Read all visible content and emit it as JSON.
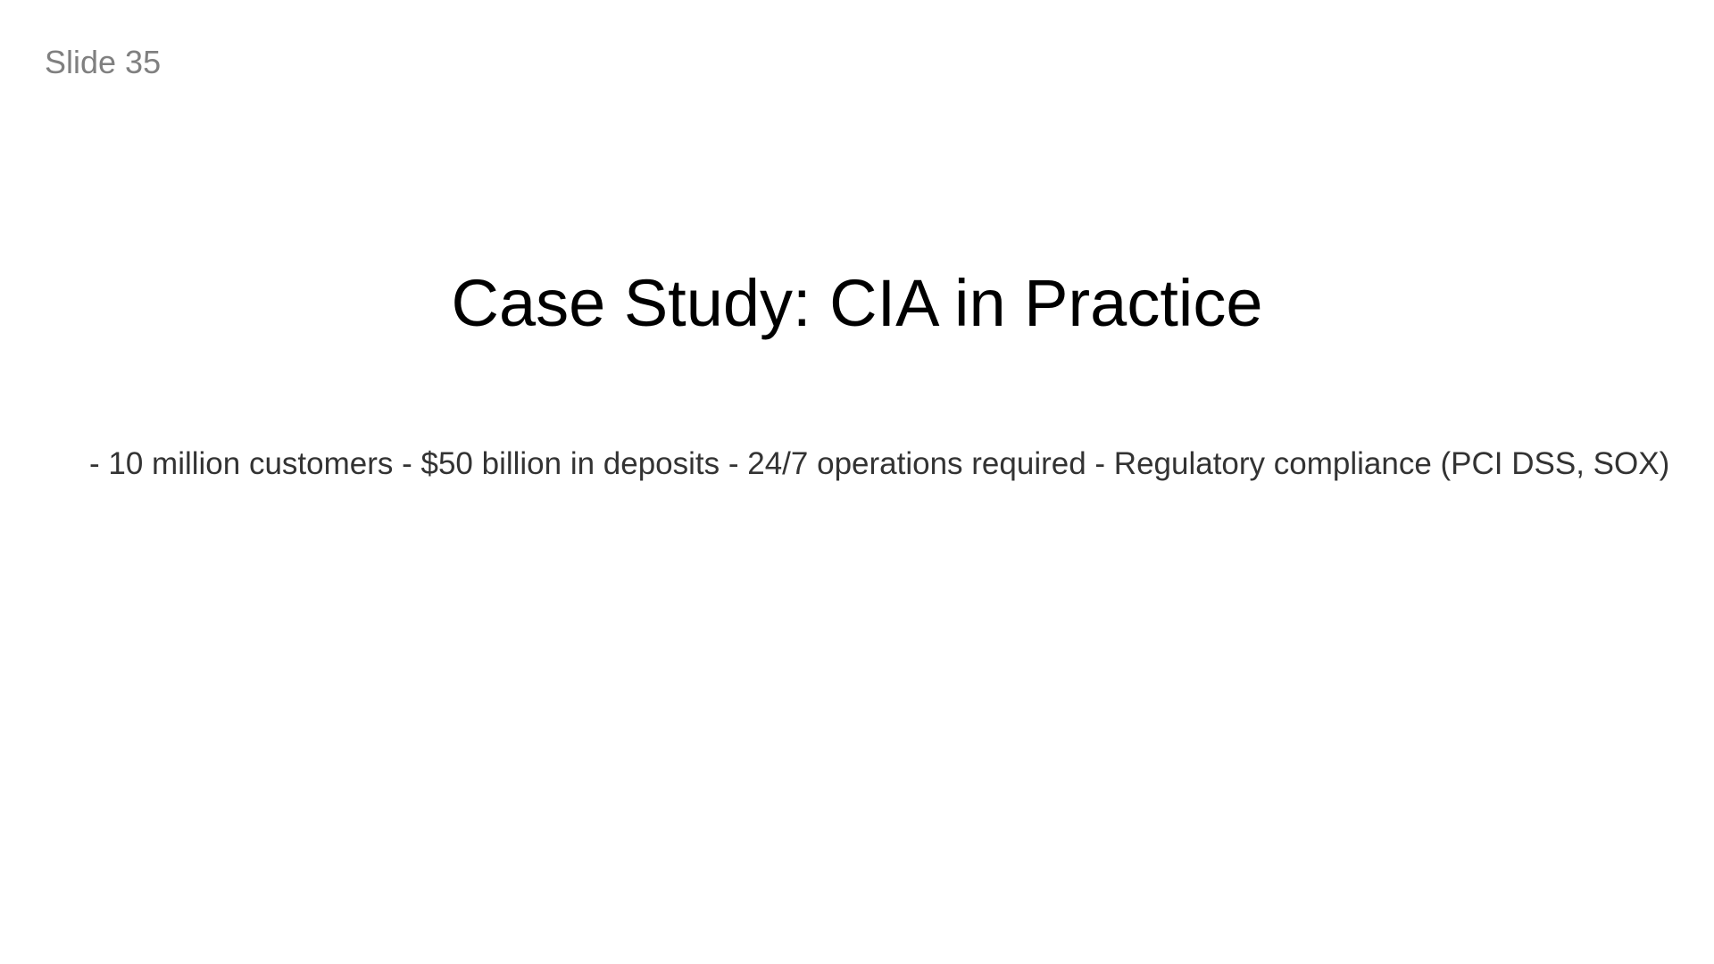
{
  "slide": {
    "number_label": "Slide 35",
    "title": "Case Study: CIA in Practice",
    "body": "- 10 million customers - $50 billion in deposits - 24/7 operations required - Regulatory compliance (PCI DSS, SOX)"
  }
}
